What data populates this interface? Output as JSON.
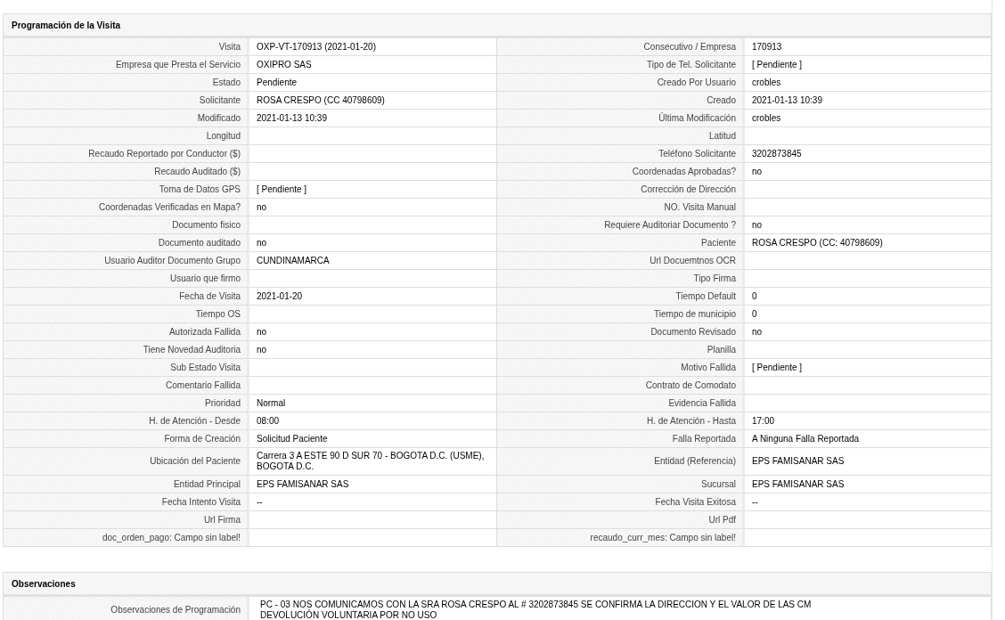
{
  "sections": [
    {
      "title": "Programación de la Visita",
      "kind": "grid",
      "rows": [
        {
          "cells": [
            {
              "label": "Visita",
              "value": "OXP-VT-170913 (2021-01-20)"
            },
            {
              "label": "Consecutivo / Empresa",
              "value": "170913"
            }
          ]
        },
        {
          "cells": [
            {
              "label": "Empresa que Presta el Servicio",
              "value": "OXIPRO SAS"
            },
            {
              "label": "Tipo de Tel. Solicitante",
              "value": "[ Pendiente ]"
            }
          ]
        },
        {
          "cells": [
            {
              "label": "Estado",
              "value": "Pendiente"
            },
            {
              "label": "Creado Por Usuario",
              "value": "crobles"
            }
          ]
        },
        {
          "cells": [
            {
              "label": "Solicitante",
              "value": "ROSA CRESPO (CC 40798609)"
            },
            {
              "label": "Creado",
              "value": "2021-01-13 10:39"
            }
          ]
        },
        {
          "cells": [
            {
              "label": "Modificado",
              "value": "2021-01-13 10:39"
            },
            {
              "label": "Última Modificación",
              "value": "crobles"
            }
          ]
        },
        {
          "cells": [
            {
              "label": "Longitud"
            },
            {
              "label": "Latitud"
            }
          ]
        },
        {
          "cells": [
            {
              "label": "Recaudo Reportado por Conductor ($)"
            },
            {
              "label": "Teléfono Solicitante",
              "value": "3202873845"
            }
          ]
        },
        {
          "cells": [
            {
              "label": "Recaudo Auditado ($)"
            },
            {
              "label": "Coordenadas Aprobadas?",
              "value": "no"
            }
          ]
        },
        {
          "cells": [
            {
              "label": "Toma de Datos GPS",
              "value": "[ Pendiente ]"
            },
            {
              "label": "Corrección de Dirección"
            }
          ]
        },
        {
          "cells": [
            {
              "label": "Coordenadas Verificadas en Mapa?",
              "value": "no"
            },
            {
              "label": "NO. Visita Manual"
            }
          ]
        },
        {
          "cells": [
            {
              "label": "Documento fisico"
            },
            {
              "label": "Requiere Auditoriar Documento ?",
              "value": "no"
            }
          ]
        },
        {
          "cells": [
            {
              "label": "Documento auditado",
              "value": "no"
            },
            {
              "label": "Paciente",
              "value": "ROSA CRESPO (CC: 40798609)"
            }
          ]
        },
        {
          "cells": [
            {
              "label": "Usuario Auditor Documento Grupo",
              "value": "CUNDINAMARCA"
            },
            {
              "label": "Url Docuemtnos OCR"
            }
          ]
        },
        {
          "cells": [
            {
              "label": "Usuario que firmo"
            },
            {
              "label": "Tipo Firma"
            }
          ]
        },
        {
          "cells": [
            {
              "label": "Fecha de Visita",
              "value": "2021-01-20"
            },
            {
              "label": "Tiempo Default",
              "value": "0"
            }
          ]
        },
        {
          "cells": [
            {
              "label": "Tiempo OS"
            },
            {
              "label": "Tiempo de municipio",
              "value": "0"
            }
          ]
        },
        {
          "cells": [
            {
              "label": "Autorizada Fallida",
              "value": "no"
            },
            {
              "label": "Documento Revisado",
              "value": "no"
            }
          ]
        },
        {
          "cells": [
            {
              "label": "Tiene Novedad Auditoria",
              "value": "no"
            },
            {
              "label": "Planilla"
            }
          ]
        },
        {
          "cells": [
            {
              "label": "Sub Estado Visita"
            },
            {
              "label": "Motivo Fallida",
              "value": "[ Pendiente ]"
            }
          ]
        },
        {
          "cells": [
            {
              "label": "Comentario Fallida"
            },
            {
              "label": "Contrato de Comodato"
            }
          ]
        },
        {
          "cells": [
            {
              "label": "Prioridad",
              "value": "Normal"
            },
            {
              "label": "Evidencia Fallida"
            }
          ]
        },
        {
          "cells": [
            {
              "label": "H. de Atención - Desde",
              "value": "08:00"
            },
            {
              "label": "H. de Atención - Hasta",
              "value": "17:00"
            }
          ]
        },
        {
          "cells": [
            {
              "label": "Forma de Creación",
              "value": "Solicitud Paciente"
            },
            {
              "label": "Falla Reportada",
              "value": "A Ninguna Falla Reportada"
            }
          ]
        },
        {
          "cells": [
            {
              "label": "Ubicación del Paciente",
              "value": "Carrera 3 A ESTE 90 D SUR 70 - BOGOTA D.C. (USME), BOGOTA D.C."
            },
            {
              "label": "Entidad (Referencia)",
              "value": "EPS FAMISANAR SAS"
            }
          ]
        },
        {
          "cells": [
            {
              "label": "Entidad Principal",
              "value": "EPS FAMISANAR SAS"
            },
            {
              "label": "Sucursal",
              "value": "EPS FAMISANAR SAS"
            }
          ]
        },
        {
          "cells": [
            {
              "label": "Fecha Intento Visita",
              "value": "--"
            },
            {
              "label": "Fecha Visita Exitosa",
              "value": "--"
            }
          ]
        },
        {
          "cells": [
            {
              "label": "Url Firma"
            },
            {
              "label": "Url Pdf"
            }
          ]
        },
        {
          "cells": [
            {
              "label": "doc_orden_pago: Campo sin label!"
            },
            {
              "label": "recaudo_curr_mes: Campo sin label!"
            }
          ]
        }
      ]
    },
    {
      "title": "Observaciones",
      "kind": "wide",
      "rows": [
        {
          "cells": [
            {
              "label": "Observaciones de Programación",
              "value": "PC - 03 NOS COMUNICAMOS CON LA SRA ROSA CRESPO AL # 3202873845 SE CONFIRMA LA DIRECCION Y EL VALOR DE LAS CM\nDEVOLUCIÓN VOLUNTARIA POR NO USO"
            }
          ]
        }
      ]
    }
  ]
}
